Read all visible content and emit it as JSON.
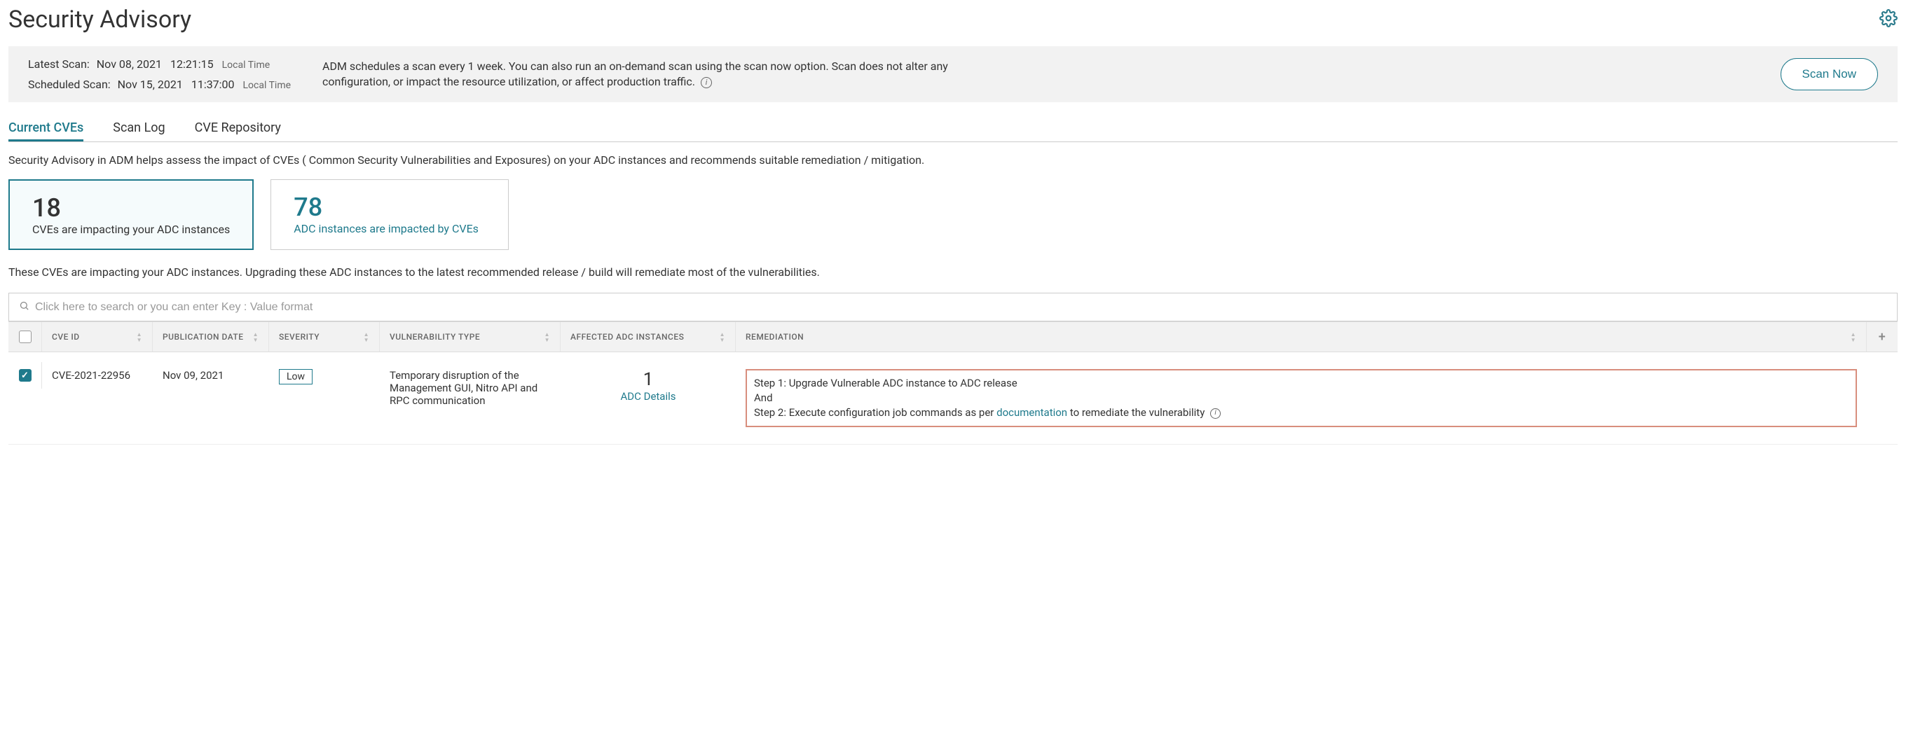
{
  "header": {
    "title": "Security Advisory"
  },
  "info_bar": {
    "latest_label": "Latest Scan:",
    "latest_date": "Nov 08, 2021",
    "latest_time": "12:21:15",
    "latest_tz": "Local Time",
    "scheduled_label": "Scheduled Scan:",
    "scheduled_date": "Nov 15, 2021",
    "scheduled_time": "11:37:00",
    "scheduled_tz": "Local Time",
    "description": "ADM schedules a scan every 1 week. You can also run an on-demand scan using the scan now option. Scan does not alter any configuration, or impact the resource utilization, or affect production traffic.",
    "scan_now": "Scan Now"
  },
  "tabs": {
    "current": "Current CVEs",
    "log": "Scan Log",
    "repo": "CVE Repository"
  },
  "advisory_desc": "Security Advisory in ADM helps assess the impact of CVEs ( Common Security Vulnerabilities and Exposures) on your ADC instances and recommends suitable remediation / mitigation.",
  "cards": {
    "impacting_count": "18",
    "impacting_label": "CVEs are impacting your ADC instances",
    "instances_count": "78",
    "instances_label": "ADC instances are impacted by CVEs"
  },
  "table_intro": "These CVEs are impacting your ADC instances. Upgrading these ADC instances to the latest recommended release / build will remediate most of the vulnerabilities.",
  "search": {
    "placeholder": "Click here to search or you can enter Key : Value format"
  },
  "table": {
    "headers": {
      "cve_id": "CVE ID",
      "pub_date": "PUBLICATION DATE",
      "severity": "SEVERITY",
      "vuln_type": "VULNERABILITY TYPE",
      "affected": "AFFECTED ADC INSTANCES",
      "remediation": "REMEDIATION"
    },
    "row": {
      "cve_id": "CVE-2021-22956",
      "pub_date": "Nov 09, 2021",
      "severity": "Low",
      "vuln_type": "Temporary disruption of the Management GUI, Nitro API and RPC communication",
      "affected_count": "1",
      "adc_details": "ADC Details",
      "rem_step1_pre": "Step 1: Upgrade Vulnerable ADC instance to ADC release",
      "rem_and": "And",
      "rem_step2_pre": "Step 2: Execute configuration job commands as per ",
      "rem_doc_link": "documentation",
      "rem_step2_post": " to remediate the vulnerability"
    }
  }
}
